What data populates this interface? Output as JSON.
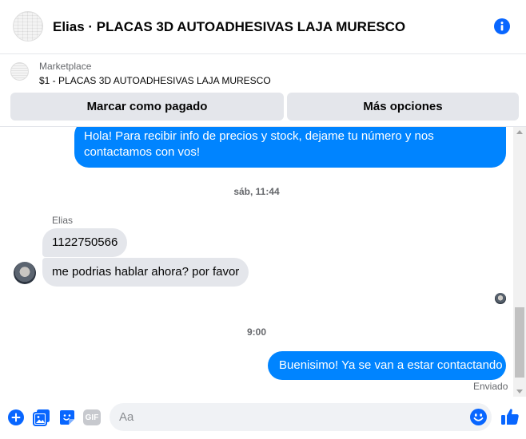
{
  "header": {
    "title": "Elias · PLACAS 3D AUTOADHESIVAS LAJA MURESCO",
    "avatar_icon": "product-photo-avatar",
    "info_icon": "info-icon"
  },
  "marketplace": {
    "label": "Marketplace",
    "item": "$1 - PLACAS 3D AUTOADHESIVAS LAJA MURESCO"
  },
  "actions": {
    "mark_paid": "Marcar como pagado",
    "more_options": "Más opciones"
  },
  "messages": {
    "outgoing_1": "Hola! Para recibir info de precios y stock, dejame tu número y nos contactamos con vos!",
    "timestamp_1": "sáb, 11:44",
    "sender_name": "Elias",
    "incoming_1": "1122750566",
    "incoming_2": "me podrias hablar ahora? por favor",
    "timestamp_2": "9:00",
    "outgoing_2": "Buenisimo! Ya se van a estar contactando",
    "status": "Enviado"
  },
  "composer": {
    "placeholder": "Aa",
    "icons": [
      "plus-icon",
      "photo-icon",
      "sticker-icon",
      "gif-icon",
      "emoji-icon",
      "thumbs-up-icon"
    ],
    "gif_label": "GIF"
  },
  "colors": {
    "accent": "#0084ff",
    "icon_blue": "#0866ff",
    "bubble_gray": "#e4e6eb",
    "text_secondary": "#65676b"
  }
}
